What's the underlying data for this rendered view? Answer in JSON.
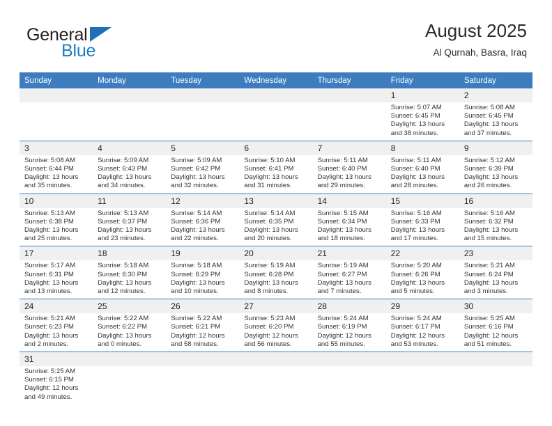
{
  "brand": {
    "name_part1": "General",
    "name_part2": "Blue",
    "logo_icon": "triangle-logo-icon",
    "colors": {
      "general": "#231f20",
      "blue": "#1b7dc4",
      "triangle": "#1e6fb8"
    }
  },
  "header": {
    "title": "August 2025",
    "location": "Al Qurnah, Basra, Iraq"
  },
  "theme": {
    "header_bg": "#3c7cbf",
    "header_text": "#ffffff",
    "daynum_bg": "#f0f0f0",
    "row_divider": "#3c7cbf"
  },
  "weekdays": [
    {
      "label": "Sunday"
    },
    {
      "label": "Monday"
    },
    {
      "label": "Tuesday"
    },
    {
      "label": "Wednesday"
    },
    {
      "label": "Thursday"
    },
    {
      "label": "Friday"
    },
    {
      "label": "Saturday"
    }
  ],
  "weeks": [
    [
      {
        "empty": true,
        "day": "",
        "sunrise": "",
        "sunset": "",
        "daylight1": "",
        "daylight2": ""
      },
      {
        "empty": true,
        "day": "",
        "sunrise": "",
        "sunset": "",
        "daylight1": "",
        "daylight2": ""
      },
      {
        "empty": true,
        "day": "",
        "sunrise": "",
        "sunset": "",
        "daylight1": "",
        "daylight2": ""
      },
      {
        "empty": true,
        "day": "",
        "sunrise": "",
        "sunset": "",
        "daylight1": "",
        "daylight2": ""
      },
      {
        "empty": true,
        "day": "",
        "sunrise": "",
        "sunset": "",
        "daylight1": "",
        "daylight2": ""
      },
      {
        "empty": false,
        "day": "1",
        "sunrise": "Sunrise: 5:07 AM",
        "sunset": "Sunset: 6:45 PM",
        "daylight1": "Daylight: 13 hours",
        "daylight2": "and 38 minutes."
      },
      {
        "empty": false,
        "day": "2",
        "sunrise": "Sunrise: 5:08 AM",
        "sunset": "Sunset: 6:45 PM",
        "daylight1": "Daylight: 13 hours",
        "daylight2": "and 37 minutes."
      }
    ],
    [
      {
        "empty": false,
        "day": "3",
        "sunrise": "Sunrise: 5:08 AM",
        "sunset": "Sunset: 6:44 PM",
        "daylight1": "Daylight: 13 hours",
        "daylight2": "and 35 minutes."
      },
      {
        "empty": false,
        "day": "4",
        "sunrise": "Sunrise: 5:09 AM",
        "sunset": "Sunset: 6:43 PM",
        "daylight1": "Daylight: 13 hours",
        "daylight2": "and 34 minutes."
      },
      {
        "empty": false,
        "day": "5",
        "sunrise": "Sunrise: 5:09 AM",
        "sunset": "Sunset: 6:42 PM",
        "daylight1": "Daylight: 13 hours",
        "daylight2": "and 32 minutes."
      },
      {
        "empty": false,
        "day": "6",
        "sunrise": "Sunrise: 5:10 AM",
        "sunset": "Sunset: 6:41 PM",
        "daylight1": "Daylight: 13 hours",
        "daylight2": "and 31 minutes."
      },
      {
        "empty": false,
        "day": "7",
        "sunrise": "Sunrise: 5:11 AM",
        "sunset": "Sunset: 6:40 PM",
        "daylight1": "Daylight: 13 hours",
        "daylight2": "and 29 minutes."
      },
      {
        "empty": false,
        "day": "8",
        "sunrise": "Sunrise: 5:11 AM",
        "sunset": "Sunset: 6:40 PM",
        "daylight1": "Daylight: 13 hours",
        "daylight2": "and 28 minutes."
      },
      {
        "empty": false,
        "day": "9",
        "sunrise": "Sunrise: 5:12 AM",
        "sunset": "Sunset: 6:39 PM",
        "daylight1": "Daylight: 13 hours",
        "daylight2": "and 26 minutes."
      }
    ],
    [
      {
        "empty": false,
        "day": "10",
        "sunrise": "Sunrise: 5:13 AM",
        "sunset": "Sunset: 6:38 PM",
        "daylight1": "Daylight: 13 hours",
        "daylight2": "and 25 minutes."
      },
      {
        "empty": false,
        "day": "11",
        "sunrise": "Sunrise: 5:13 AM",
        "sunset": "Sunset: 6:37 PM",
        "daylight1": "Daylight: 13 hours",
        "daylight2": "and 23 minutes."
      },
      {
        "empty": false,
        "day": "12",
        "sunrise": "Sunrise: 5:14 AM",
        "sunset": "Sunset: 6:36 PM",
        "daylight1": "Daylight: 13 hours",
        "daylight2": "and 22 minutes."
      },
      {
        "empty": false,
        "day": "13",
        "sunrise": "Sunrise: 5:14 AM",
        "sunset": "Sunset: 6:35 PM",
        "daylight1": "Daylight: 13 hours",
        "daylight2": "and 20 minutes."
      },
      {
        "empty": false,
        "day": "14",
        "sunrise": "Sunrise: 5:15 AM",
        "sunset": "Sunset: 6:34 PM",
        "daylight1": "Daylight: 13 hours",
        "daylight2": "and 18 minutes."
      },
      {
        "empty": false,
        "day": "15",
        "sunrise": "Sunrise: 5:16 AM",
        "sunset": "Sunset: 6:33 PM",
        "daylight1": "Daylight: 13 hours",
        "daylight2": "and 17 minutes."
      },
      {
        "empty": false,
        "day": "16",
        "sunrise": "Sunrise: 5:16 AM",
        "sunset": "Sunset: 6:32 PM",
        "daylight1": "Daylight: 13 hours",
        "daylight2": "and 15 minutes."
      }
    ],
    [
      {
        "empty": false,
        "day": "17",
        "sunrise": "Sunrise: 5:17 AM",
        "sunset": "Sunset: 6:31 PM",
        "daylight1": "Daylight: 13 hours",
        "daylight2": "and 13 minutes."
      },
      {
        "empty": false,
        "day": "18",
        "sunrise": "Sunrise: 5:18 AM",
        "sunset": "Sunset: 6:30 PM",
        "daylight1": "Daylight: 13 hours",
        "daylight2": "and 12 minutes."
      },
      {
        "empty": false,
        "day": "19",
        "sunrise": "Sunrise: 5:18 AM",
        "sunset": "Sunset: 6:29 PM",
        "daylight1": "Daylight: 13 hours",
        "daylight2": "and 10 minutes."
      },
      {
        "empty": false,
        "day": "20",
        "sunrise": "Sunrise: 5:19 AM",
        "sunset": "Sunset: 6:28 PM",
        "daylight1": "Daylight: 13 hours",
        "daylight2": "and 8 minutes."
      },
      {
        "empty": false,
        "day": "21",
        "sunrise": "Sunrise: 5:19 AM",
        "sunset": "Sunset: 6:27 PM",
        "daylight1": "Daylight: 13 hours",
        "daylight2": "and 7 minutes."
      },
      {
        "empty": false,
        "day": "22",
        "sunrise": "Sunrise: 5:20 AM",
        "sunset": "Sunset: 6:26 PM",
        "daylight1": "Daylight: 13 hours",
        "daylight2": "and 5 minutes."
      },
      {
        "empty": false,
        "day": "23",
        "sunrise": "Sunrise: 5:21 AM",
        "sunset": "Sunset: 6:24 PM",
        "daylight1": "Daylight: 13 hours",
        "daylight2": "and 3 minutes."
      }
    ],
    [
      {
        "empty": false,
        "day": "24",
        "sunrise": "Sunrise: 5:21 AM",
        "sunset": "Sunset: 6:23 PM",
        "daylight1": "Daylight: 13 hours",
        "daylight2": "and 2 minutes."
      },
      {
        "empty": false,
        "day": "25",
        "sunrise": "Sunrise: 5:22 AM",
        "sunset": "Sunset: 6:22 PM",
        "daylight1": "Daylight: 13 hours",
        "daylight2": "and 0 minutes."
      },
      {
        "empty": false,
        "day": "26",
        "sunrise": "Sunrise: 5:22 AM",
        "sunset": "Sunset: 6:21 PM",
        "daylight1": "Daylight: 12 hours",
        "daylight2": "and 58 minutes."
      },
      {
        "empty": false,
        "day": "27",
        "sunrise": "Sunrise: 5:23 AM",
        "sunset": "Sunset: 6:20 PM",
        "daylight1": "Daylight: 12 hours",
        "daylight2": "and 56 minutes."
      },
      {
        "empty": false,
        "day": "28",
        "sunrise": "Sunrise: 5:24 AM",
        "sunset": "Sunset: 6:19 PM",
        "daylight1": "Daylight: 12 hours",
        "daylight2": "and 55 minutes."
      },
      {
        "empty": false,
        "day": "29",
        "sunrise": "Sunrise: 5:24 AM",
        "sunset": "Sunset: 6:17 PM",
        "daylight1": "Daylight: 12 hours",
        "daylight2": "and 53 minutes."
      },
      {
        "empty": false,
        "day": "30",
        "sunrise": "Sunrise: 5:25 AM",
        "sunset": "Sunset: 6:16 PM",
        "daylight1": "Daylight: 12 hours",
        "daylight2": "and 51 minutes."
      }
    ],
    [
      {
        "empty": false,
        "day": "31",
        "sunrise": "Sunrise: 5:25 AM",
        "sunset": "Sunset: 6:15 PM",
        "daylight1": "Daylight: 12 hours",
        "daylight2": "and 49 minutes."
      },
      {
        "empty": true,
        "day": "",
        "sunrise": "",
        "sunset": "",
        "daylight1": "",
        "daylight2": ""
      },
      {
        "empty": true,
        "day": "",
        "sunrise": "",
        "sunset": "",
        "daylight1": "",
        "daylight2": ""
      },
      {
        "empty": true,
        "day": "",
        "sunrise": "",
        "sunset": "",
        "daylight1": "",
        "daylight2": ""
      },
      {
        "empty": true,
        "day": "",
        "sunrise": "",
        "sunset": "",
        "daylight1": "",
        "daylight2": ""
      },
      {
        "empty": true,
        "day": "",
        "sunrise": "",
        "sunset": "",
        "daylight1": "",
        "daylight2": ""
      },
      {
        "empty": true,
        "day": "",
        "sunrise": "",
        "sunset": "",
        "daylight1": "",
        "daylight2": ""
      }
    ]
  ]
}
